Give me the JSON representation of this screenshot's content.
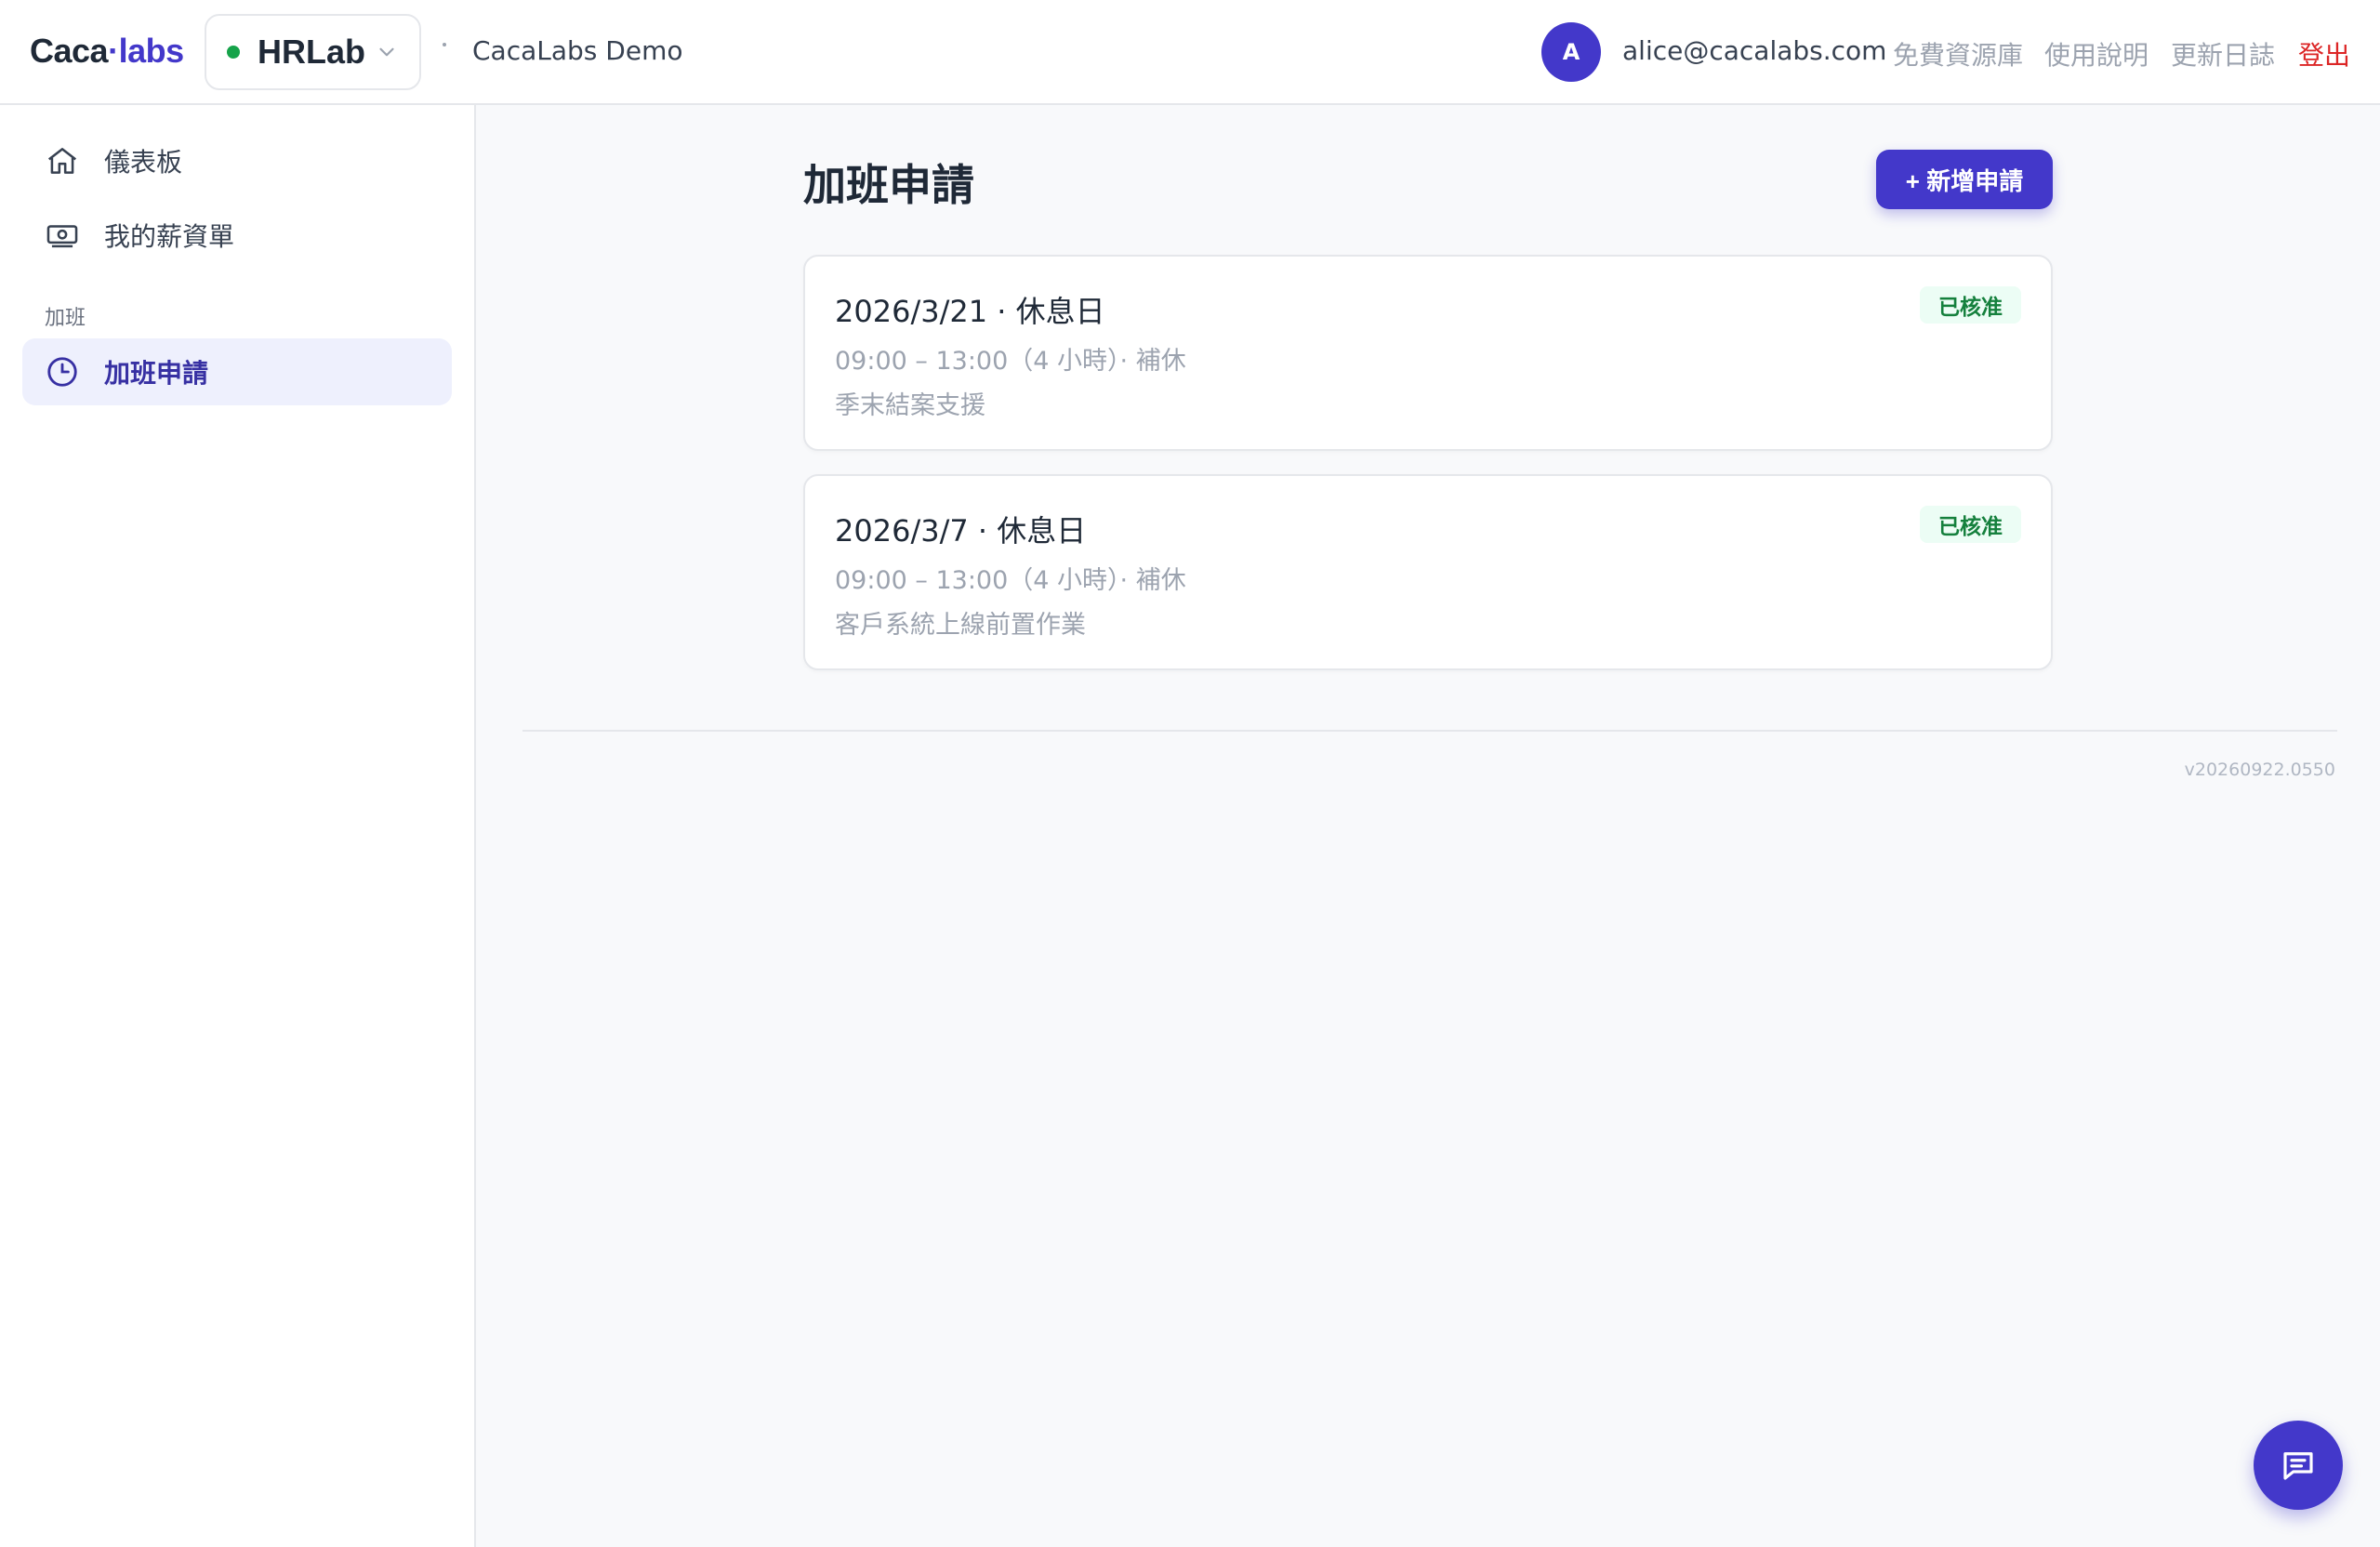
{
  "header": {
    "logo_text": "Caca",
    "logo_dot": "·",
    "logo_suffix": "labs",
    "app_name": "HRLab",
    "org_name": "CacaLabs Demo",
    "avatar_initial": "A",
    "user_email": "alice@cacalabs.com",
    "links": {
      "resources": "免費資源庫",
      "manual": "使用說明",
      "changelog": "更新日誌",
      "logout": "登出"
    }
  },
  "sidebar": {
    "items": [
      {
        "label": "儀表板",
        "icon": "home-icon"
      },
      {
        "label": "我的薪資單",
        "icon": "money-icon"
      }
    ],
    "section_title": "加班",
    "section_items": [
      {
        "label": "加班申請",
        "icon": "clock-icon",
        "active": true
      }
    ]
  },
  "main": {
    "title": "加班申請",
    "new_button": "+ 新增申請",
    "requests": [
      {
        "title": "2026/3/21 · 休息日",
        "time": "09:00 – 13:00（4 小時）· 補休",
        "note": "季末結案支援",
        "status": "已核准"
      },
      {
        "title": "2026/3/7 · 休息日",
        "time": "09:00 – 13:00（4 小時）· 補休",
        "note": "客戶系統上線前置作業",
        "status": "已核准"
      }
    ],
    "version": "v20260922.0550"
  },
  "colors": {
    "accent": "#4338ca",
    "success": "#15803d",
    "danger": "#dc2626"
  }
}
